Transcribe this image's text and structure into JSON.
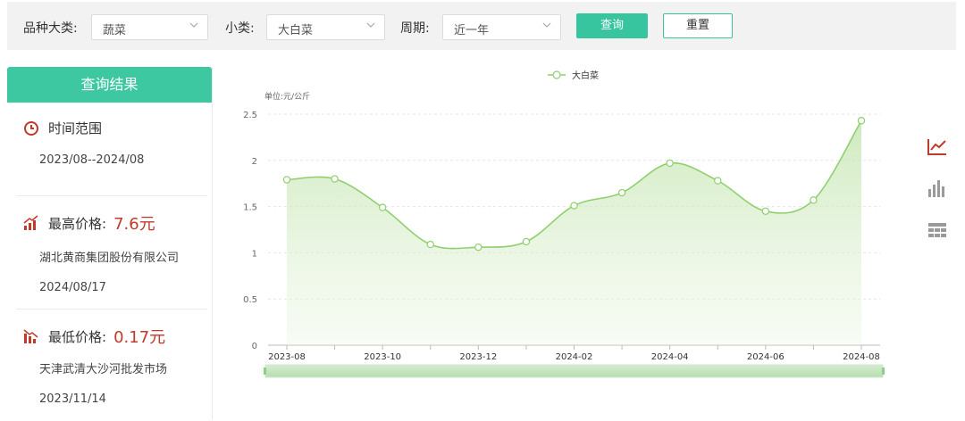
{
  "filters": {
    "category_label": "品种大类:",
    "category_value": "蔬菜",
    "subcategory_label": "小类:",
    "subcategory_value": "大白菜",
    "period_label": "周期:",
    "period_value": "近一年",
    "query_button": "查询",
    "reset_button": "重置"
  },
  "results": {
    "header": "查询结果",
    "time_range_label": "时间范围",
    "time_range_value": "2023/08--2024/08",
    "max_label": "最高价格:",
    "max_price": "7.6元",
    "max_market": "湖北黄商集团股份有限公司",
    "max_date": "2024/08/17",
    "min_label": "最低价格:",
    "min_price": "0.17元",
    "min_market": "天津武清大沙河批发市场",
    "min_date": "2023/11/14"
  },
  "colors": {
    "accent": "#37c5a0",
    "line": "#8fcf6e",
    "price_red": "#c0392b"
  },
  "icons": [
    "clock-icon",
    "price-up-icon",
    "price-down-icon",
    "line-chart-icon",
    "bar-chart-icon",
    "table-icon"
  ],
  "chart_data": {
    "type": "line",
    "unit_label": "单位:元/公斤",
    "legend": "大白菜",
    "x": [
      "2023-08",
      "2023-09",
      "2023-10",
      "2023-11",
      "2023-12",
      "2024-01",
      "2024-02",
      "2024-03",
      "2024-04",
      "2024-05",
      "2024-06",
      "2024-07",
      "2024-08"
    ],
    "x_tick_labels": [
      "2023-08",
      "2023-10",
      "2023-12",
      "2024-02",
      "2024-04",
      "2024-06",
      "2024-08"
    ],
    "series": [
      {
        "name": "大白菜",
        "values": [
          1.79,
          1.8,
          1.49,
          1.09,
          1.06,
          1.12,
          1.51,
          1.65,
          1.97,
          1.78,
          1.45,
          1.57,
          2.43
        ]
      }
    ],
    "y_ticks": [
      "0",
      "0.5",
      "1",
      "1.5",
      "2",
      "2.5"
    ],
    "ylim": [
      0,
      2.5
    ],
    "grid": true
  }
}
